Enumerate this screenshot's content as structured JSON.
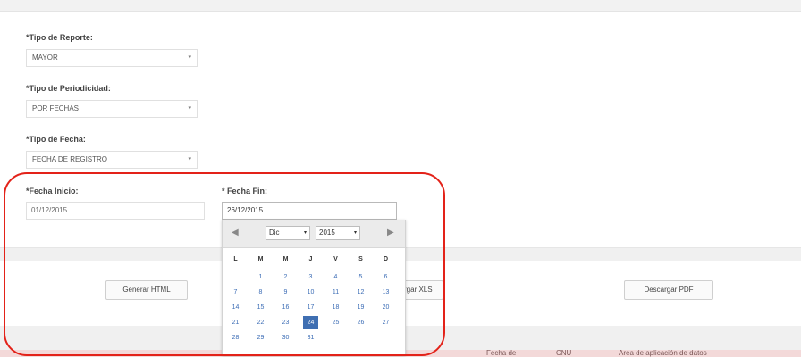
{
  "form": {
    "tipo_reporte_label": "*Tipo de Reporte:",
    "tipo_reporte_value": "MAYOR",
    "tipo_periodicidad_label": "*Tipo de Periodicidad:",
    "tipo_periodicidad_value": "POR FECHAS",
    "tipo_fecha_label": "*Tipo de Fecha:",
    "tipo_fecha_value": "FECHA DE REGISTRO",
    "fecha_inicio_label": "*Fecha Inicio:",
    "fecha_inicio_value": "01/12/2015",
    "fecha_fin_label": "* Fecha Fin:",
    "fecha_fin_value": "26/12/2015",
    "chevron": "▾"
  },
  "buttons": {
    "generar_html": "Generar HTML",
    "descargar_xls_partial": "rgar XLS",
    "descargar_pdf": "Descargar PDF"
  },
  "datepicker": {
    "prev_icon": "◀",
    "next_icon": "▶",
    "month": "Dic",
    "year": "2015",
    "weekdays": [
      "L",
      "M",
      "M",
      "J",
      "V",
      "S",
      "D"
    ],
    "weeks": [
      [
        "",
        "1",
        "2",
        "3",
        "4",
        "5",
        "6"
      ],
      [
        "7",
        "8",
        "9",
        "10",
        "11",
        "12",
        "13"
      ],
      [
        "14",
        "15",
        "16",
        "17",
        "18",
        "19",
        "20"
      ],
      [
        "21",
        "22",
        "23",
        "24",
        "25",
        "26",
        "27"
      ],
      [
        "28",
        "29",
        "30",
        "31",
        "",
        "",
        ""
      ]
    ],
    "selected_day": "24"
  },
  "table_header": {
    "col_fecha": "Fecha de",
    "col_cnu": "CNU",
    "col_area": "Area de aplicación de datos"
  },
  "colors": {
    "highlight": "#e32219",
    "selected_day_bg": "#3f6fb2"
  }
}
